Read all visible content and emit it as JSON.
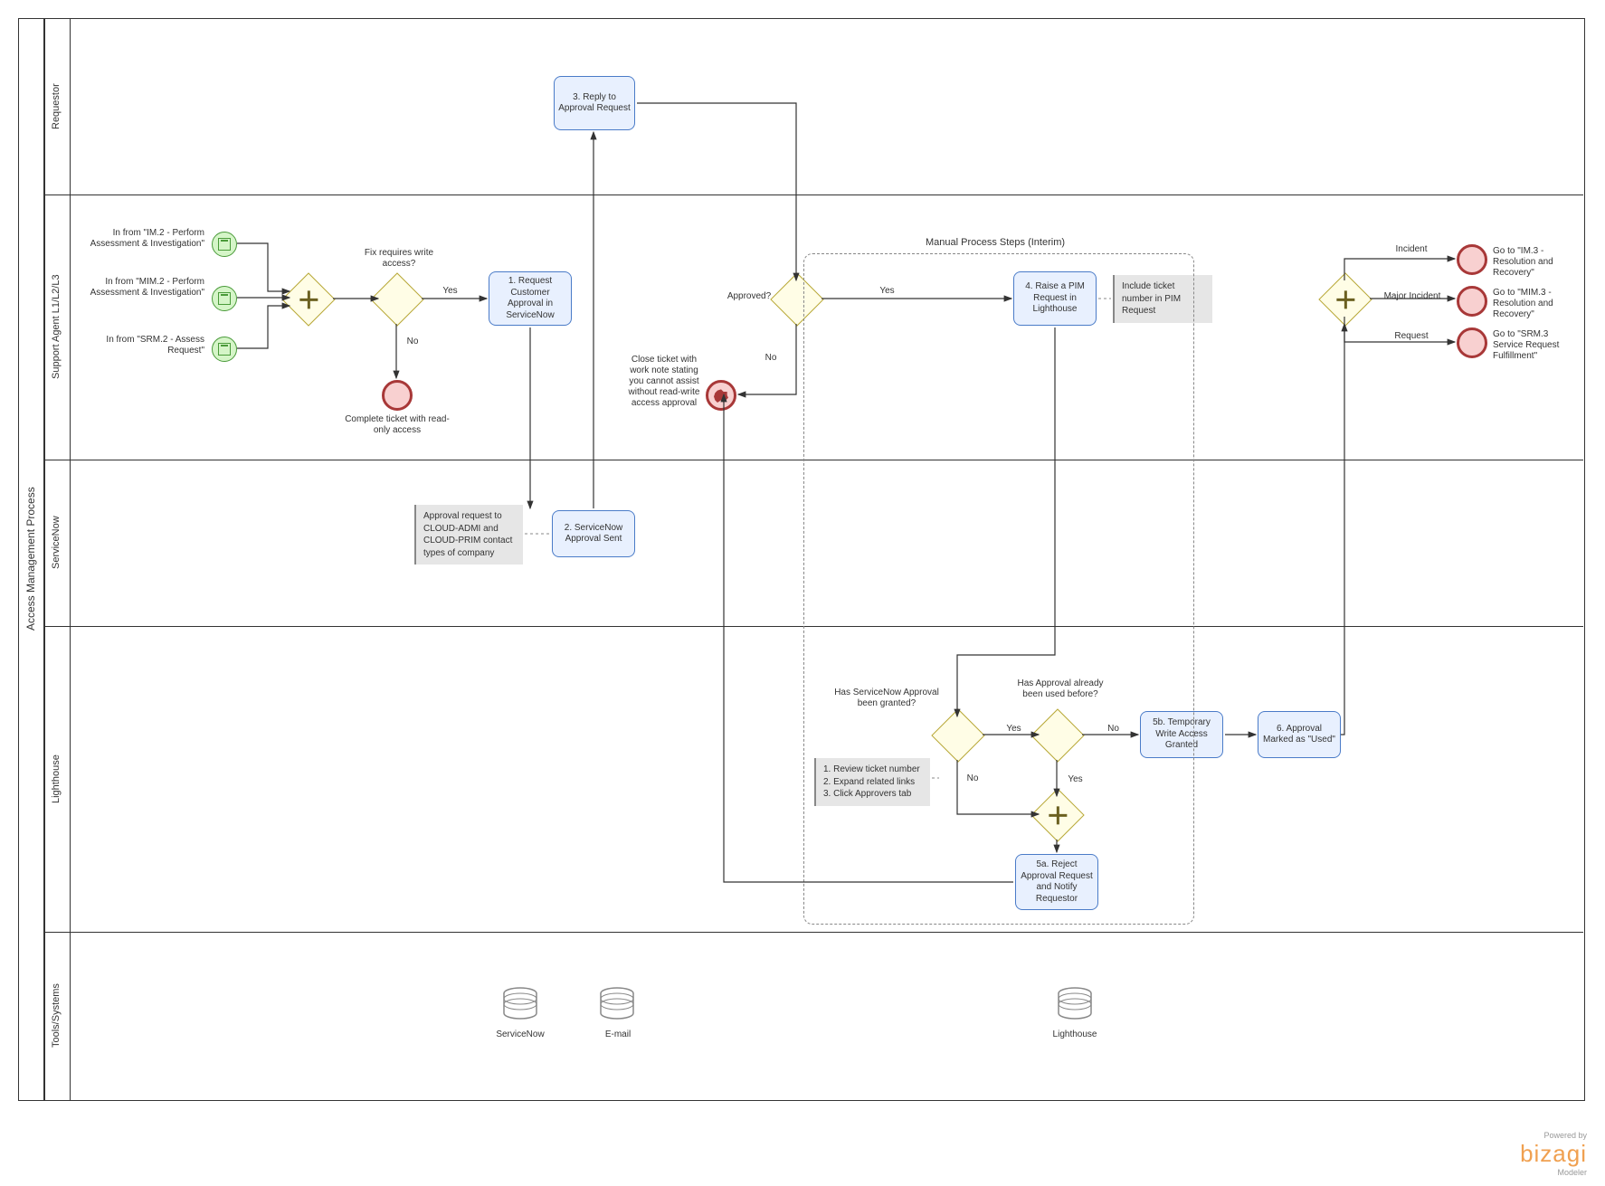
{
  "pool": {
    "title": "Access Management Process"
  },
  "lanes": {
    "requestor": "Requestor",
    "support": "Support Agent L1/L2/L3",
    "servicenow": "ServiceNow",
    "lighthouse": "Lighthouse",
    "tools": "Tools/Systems"
  },
  "startEvents": {
    "im2": "In from \"IM.2 - Perform Assessment & Investigation\"",
    "mim2": "In from \"MIM.2 - Perform Assessment & Investigation\"",
    "srm2": "In from \"SRM.2 - Assess Request\""
  },
  "gateways": {
    "fixRequires": "Fix requires write access?",
    "fixYes": "Yes",
    "fixNo": "No",
    "approved": "Approved?",
    "approvedYes": "Yes",
    "approvedNo": "No",
    "snApproval": "Has ServiceNow Approval been granted?",
    "snYes": "Yes",
    "snNo": "No",
    "usedBefore": "Has Approval already been used before?",
    "usedYes": "Yes",
    "usedNo": "No",
    "routeIncident": "Incident",
    "routeMajor": "Major Incident",
    "routeRequest": "Request"
  },
  "tasks": {
    "t1": "1. Request Customer Approval in ServiceNow",
    "t2": "2. ServiceNow Approval Sent",
    "t3": "3. Reply to Approval Request",
    "t4": "4. Raise a PIM Request in Lighthouse",
    "t5a": "5a. Reject Approval Request and Notify Requestor",
    "t5b": "5b. Temporary Write Access Granted",
    "t6": "6. Approval Marked as \"Used\""
  },
  "ends": {
    "complete": "Complete ticket with read-only access",
    "close": "Close ticket with work note stating you cannot assist without read-write access approval",
    "im3": "Go to \"IM.3 - Resolution and Recovery\"",
    "mim3": "Go to \"MIM.3 - Resolution and Recovery\"",
    "srm3": "Go to \"SRM.3 Service Request Fulfillment\""
  },
  "annotations": {
    "approvalReq": "Approval request to CLOUD-ADMI and CLOUD-PRIM contact types of company",
    "pimNote": "Include ticket number in PIM Request",
    "reviewSteps": "1. Review ticket number\n2. Expand related links\n3. Click Approvers tab"
  },
  "group": {
    "label": "Manual Process Steps (Interim)"
  },
  "datastores": {
    "servicenow": "ServiceNow",
    "email": "E-mail",
    "lighthouse": "Lighthouse"
  },
  "footer": {
    "poweredBy": "Powered by",
    "brand": "bizagi",
    "sub": "Modeler"
  }
}
